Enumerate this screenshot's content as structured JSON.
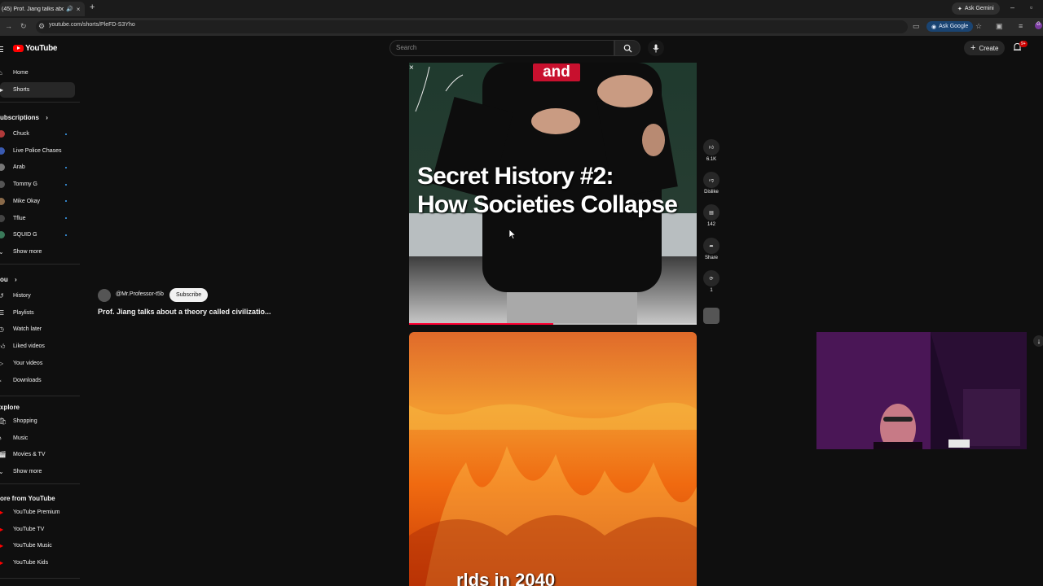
{
  "browser": {
    "tab_title": "(45) Prof. Jiang talks about",
    "tab_close": "×",
    "new_tab": "+",
    "ask_gemini": "Ask Gemini",
    "url": "youtube.com/shorts/PleFD-S3Yho",
    "ask_google": "Ask Google"
  },
  "header": {
    "logo_text": "YouTube",
    "search_placeholder": "Search",
    "create_label": "Create",
    "notification_count": "9+"
  },
  "sidebar": {
    "main": [
      {
        "label": "Home",
        "icon": "home-icon",
        "active": false
      },
      {
        "label": "Shorts",
        "icon": "shorts-icon",
        "active": true
      }
    ],
    "subscriptions_heading": "ubscriptions",
    "subscriptions": [
      {
        "label": "Chuck",
        "dot": true,
        "color": "#b03a3a"
      },
      {
        "label": "Live Police Chases",
        "dot": false,
        "color": "#3a5ab0"
      },
      {
        "label": "Arab",
        "dot": true,
        "color": "#777777"
      },
      {
        "label": "Tommy G",
        "dot": true,
        "color": "#555555"
      },
      {
        "label": "Mike Okay",
        "dot": true,
        "color": "#8a6a4a"
      },
      {
        "label": "Tflue",
        "dot": true,
        "color": "#444444"
      },
      {
        "label": "SQUID G",
        "dot": true,
        "color": "#3a7a5a"
      }
    ],
    "show_more_1": "Show more",
    "you_heading": "ou",
    "you": [
      {
        "label": "History",
        "icon": "history-icon"
      },
      {
        "label": "Playlists",
        "icon": "playlists-icon"
      },
      {
        "label": "Watch later",
        "icon": "watch-later-icon"
      },
      {
        "label": "Liked videos",
        "icon": "liked-videos-icon"
      },
      {
        "label": "Your videos",
        "icon": "your-videos-icon"
      },
      {
        "label": "Downloads",
        "icon": "downloads-icon"
      }
    ],
    "explore_heading": "xplore",
    "explore": [
      {
        "label": "Shopping",
        "icon": "shopping-icon"
      },
      {
        "label": "Music",
        "icon": "music-icon"
      },
      {
        "label": "Movies & TV",
        "icon": "movies-icon"
      }
    ],
    "show_more_2": "Show more",
    "more_heading": "ore from YouTube",
    "more": [
      {
        "label": "YouTube Premium"
      },
      {
        "label": "YouTube TV"
      },
      {
        "label": "YouTube Music"
      },
      {
        "label": "YouTube Kids"
      }
    ]
  },
  "short": {
    "overlay_word": "and",
    "title_line1": "Secret History #2:",
    "title_line2": "How Societies Collapse",
    "progress_fraction": 0.5,
    "channel": "@Mr.Professor-t5b",
    "subscribe": "Subscribe",
    "description": "Prof. Jiang talks about a theory called civilizatio...",
    "next_caption": "rlds in 2040"
  },
  "actions": {
    "likes": "6.1K",
    "dislike": "Dislike",
    "comments": "142",
    "share": "Share",
    "remix": "1"
  }
}
